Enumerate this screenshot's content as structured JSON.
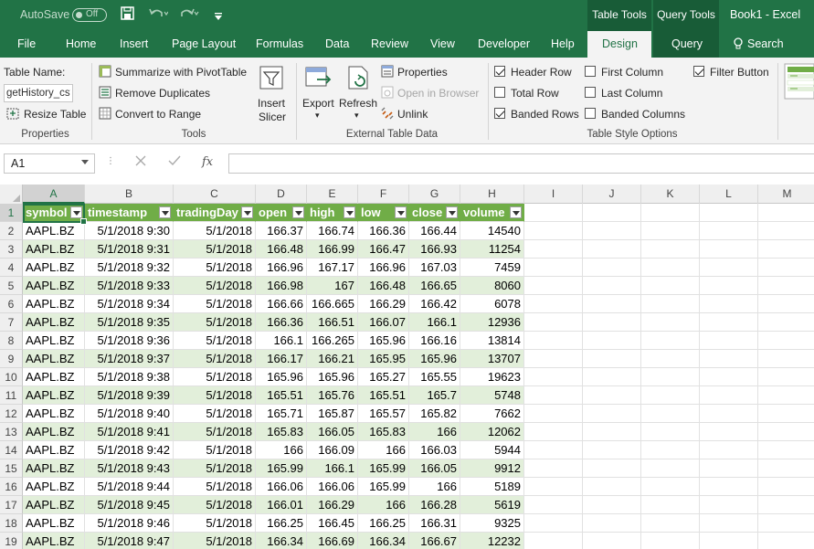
{
  "titlebar": {
    "autosave_label": "AutoSave",
    "autosave_state": "Off",
    "context_table": "Table Tools",
    "context_query": "Query Tools",
    "book_title": "Book1 - Excel"
  },
  "tabs": [
    "File",
    "Home",
    "Insert",
    "Page Layout",
    "Formulas",
    "Data",
    "Review",
    "View",
    "Developer",
    "Help",
    "Design",
    "Query"
  ],
  "active_tab": "Design",
  "search_label": "Search",
  "ribbon": {
    "properties": {
      "table_name_label": "Table Name:",
      "table_name_value": "getHistory_csv",
      "resize_label": "Resize Table",
      "group_label": "Properties"
    },
    "tools": {
      "summarize_label": "Summarize with PivotTable",
      "remove_dup_label": "Remove Duplicates",
      "convert_label": "Convert to Range",
      "insert_slicer_line1": "Insert",
      "insert_slicer_line2": "Slicer",
      "group_label": "Tools"
    },
    "external": {
      "export_label": "Export",
      "refresh_label": "Refresh",
      "properties_label": "Properties",
      "open_browser_label": "Open in Browser",
      "unlink_label": "Unlink",
      "group_label": "External Table Data"
    },
    "style_options": {
      "header_row": "Header Row",
      "total_row": "Total Row",
      "banded_rows": "Banded Rows",
      "first_column": "First Column",
      "last_column": "Last Column",
      "banded_columns": "Banded Columns",
      "filter_button": "Filter Button",
      "header_row_checked": true,
      "total_row_checked": false,
      "banded_rows_checked": true,
      "first_column_checked": false,
      "last_column_checked": false,
      "banded_columns_checked": false,
      "filter_button_checked": true,
      "group_label": "Table Style Options"
    }
  },
  "formula_bar": {
    "name_box": "A1",
    "fx_symbol": "fx",
    "value": ""
  },
  "grid": {
    "columns": [
      "A",
      "B",
      "C",
      "D",
      "E",
      "F",
      "G",
      "H",
      "I",
      "J",
      "K",
      "L",
      "M"
    ],
    "headers": [
      "symbol",
      "timestamp",
      "tradingDay",
      "open",
      "high",
      "low",
      "close",
      "volume"
    ],
    "rows": [
      [
        "AAPL.BZ",
        "5/1/2018 9:30",
        "5/1/2018",
        "166.37",
        "166.74",
        "166.36",
        "166.44",
        "14540"
      ],
      [
        "AAPL.BZ",
        "5/1/2018 9:31",
        "5/1/2018",
        "166.48",
        "166.99",
        "166.47",
        "166.93",
        "11254"
      ],
      [
        "AAPL.BZ",
        "5/1/2018 9:32",
        "5/1/2018",
        "166.96",
        "167.17",
        "166.96",
        "167.03",
        "7459"
      ],
      [
        "AAPL.BZ",
        "5/1/2018 9:33",
        "5/1/2018",
        "166.98",
        "167",
        "166.48",
        "166.65",
        "8060"
      ],
      [
        "AAPL.BZ",
        "5/1/2018 9:34",
        "5/1/2018",
        "166.66",
        "166.665",
        "166.29",
        "166.42",
        "6078"
      ],
      [
        "AAPL.BZ",
        "5/1/2018 9:35",
        "5/1/2018",
        "166.36",
        "166.51",
        "166.07",
        "166.1",
        "12936"
      ],
      [
        "AAPL.BZ",
        "5/1/2018 9:36",
        "5/1/2018",
        "166.1",
        "166.265",
        "165.96",
        "166.16",
        "13814"
      ],
      [
        "AAPL.BZ",
        "5/1/2018 9:37",
        "5/1/2018",
        "166.17",
        "166.21",
        "165.95",
        "165.96",
        "13707"
      ],
      [
        "AAPL.BZ",
        "5/1/2018 9:38",
        "5/1/2018",
        "165.96",
        "165.96",
        "165.27",
        "165.55",
        "19623"
      ],
      [
        "AAPL.BZ",
        "5/1/2018 9:39",
        "5/1/2018",
        "165.51",
        "165.76",
        "165.51",
        "165.7",
        "5748"
      ],
      [
        "AAPL.BZ",
        "5/1/2018 9:40",
        "5/1/2018",
        "165.71",
        "165.87",
        "165.57",
        "165.82",
        "7662"
      ],
      [
        "AAPL.BZ",
        "5/1/2018 9:41",
        "5/1/2018",
        "165.83",
        "166.05",
        "165.83",
        "166",
        "12062"
      ],
      [
        "AAPL.BZ",
        "5/1/2018 9:42",
        "5/1/2018",
        "166",
        "166.09",
        "166",
        "166.03",
        "5944"
      ],
      [
        "AAPL.BZ",
        "5/1/2018 9:43",
        "5/1/2018",
        "165.99",
        "166.1",
        "165.99",
        "166.05",
        "9912"
      ],
      [
        "AAPL.BZ",
        "5/1/2018 9:44",
        "5/1/2018",
        "166.06",
        "166.06",
        "165.99",
        "166",
        "5189"
      ],
      [
        "AAPL.BZ",
        "5/1/2018 9:45",
        "5/1/2018",
        "166.01",
        "166.29",
        "166",
        "166.28",
        "5619"
      ],
      [
        "AAPL.BZ",
        "5/1/2018 9:46",
        "5/1/2018",
        "166.25",
        "166.45",
        "166.25",
        "166.31",
        "9325"
      ],
      [
        "AAPL.BZ",
        "5/1/2018 9:47",
        "5/1/2018",
        "166.34",
        "166.69",
        "166.34",
        "166.67",
        "12232"
      ]
    ]
  },
  "colors": {
    "excel_green": "#217346",
    "table_header": "#70ad47",
    "band": "#e2efda"
  }
}
